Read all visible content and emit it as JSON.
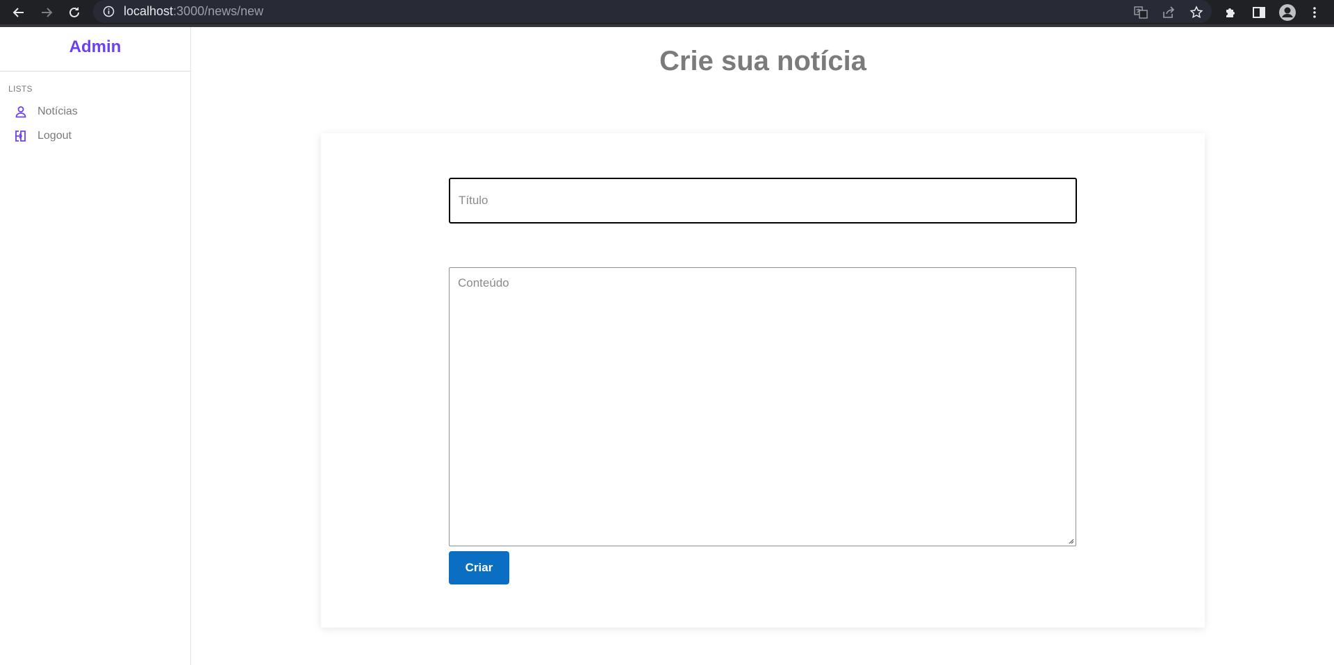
{
  "browser": {
    "url_host": "localhost",
    "url_path": ":3000/news/new"
  },
  "sidebar": {
    "brand": "Admin",
    "section_label": "LISTS",
    "items": [
      {
        "label": "Notícias",
        "icon": "user-icon"
      },
      {
        "label": "Logout",
        "icon": "logout-icon"
      }
    ]
  },
  "main": {
    "title": "Crie sua notícia",
    "form": {
      "title_placeholder": "Título",
      "title_value": "",
      "content_placeholder": "Conteúdo",
      "content_value": "",
      "submit_label": "Criar"
    }
  },
  "colors": {
    "brand": "#6e3ef3",
    "button": "#0a6fc2",
    "chrome_bg": "#202124"
  }
}
